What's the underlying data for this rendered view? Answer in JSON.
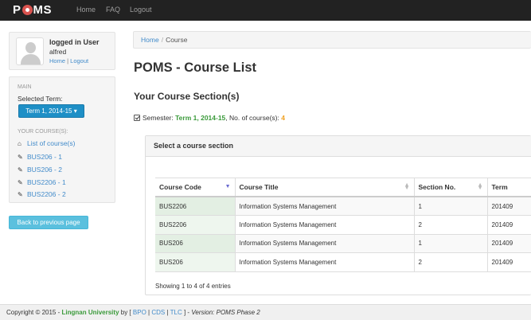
{
  "navbar": {
    "logo_prefix": "P",
    "logo_suffix": "MS",
    "links": [
      "Home",
      "FAQ",
      "Logout"
    ]
  },
  "user": {
    "title": "logged in User",
    "name": "alfred",
    "home_link": "Home",
    "logout_link": "Logout",
    "link_separator": "|"
  },
  "menu": {
    "main_header": "MAIN",
    "selected_term_label": "Selected Term:",
    "term_button": "Term 1, 2014-15 ▾",
    "courses_header": "YOUR COURSE(S):",
    "items": [
      {
        "label": "List of course(s)",
        "icon": "home-icon"
      },
      {
        "label": "BUS206 - 1",
        "icon": "edit-icon"
      },
      {
        "label": "BUS206 - 2",
        "icon": "edit-icon"
      },
      {
        "label": "BUS2206 - 1",
        "icon": "edit-icon"
      },
      {
        "label": "BUS2206 - 2",
        "icon": "edit-icon"
      }
    ],
    "back_button": "Back to previous page"
  },
  "breadcrumb": {
    "home": "Home",
    "separator": "/",
    "current": "Course"
  },
  "main": {
    "page_title": "POMS - Course List",
    "section_title": "Your Course Section(s)",
    "semester_label": "Semester:",
    "semester_value": "Term 1, 2014-15",
    "count_label": ", No. of course(s):",
    "count_value": "4"
  },
  "table": {
    "panel_title": "Select a course section",
    "columns": [
      "Course Code",
      "Course Title",
      "Section No.",
      "Term"
    ],
    "rows": [
      [
        "BUS2206",
        "Information Systems Management",
        "1",
        "201409"
      ],
      [
        "BUS2206",
        "Information Systems Management",
        "2",
        "201409"
      ],
      [
        "BUS206",
        "Information Systems Management",
        "1",
        "201409"
      ],
      [
        "BUS206",
        "Information Systems Management",
        "2",
        "201409"
      ]
    ],
    "info": "Showing 1 to 4 of 4 entries"
  },
  "footer": {
    "copyright": "Copyright © 2015 -",
    "university": "Lingnan University",
    "by": "by [",
    "links": [
      "BPO",
      "CDS",
      "TLC"
    ],
    "link_sep": "|",
    "close": "] -",
    "version": "Version: POMS Phase 2"
  },
  "colors": {
    "navbar_bg": "#222222",
    "primary_blue": "#1e8fc6",
    "info_button": "#5bc0de",
    "link": "#428bca",
    "term_green": "#3a9a3a",
    "count_orange": "#f0a020"
  }
}
